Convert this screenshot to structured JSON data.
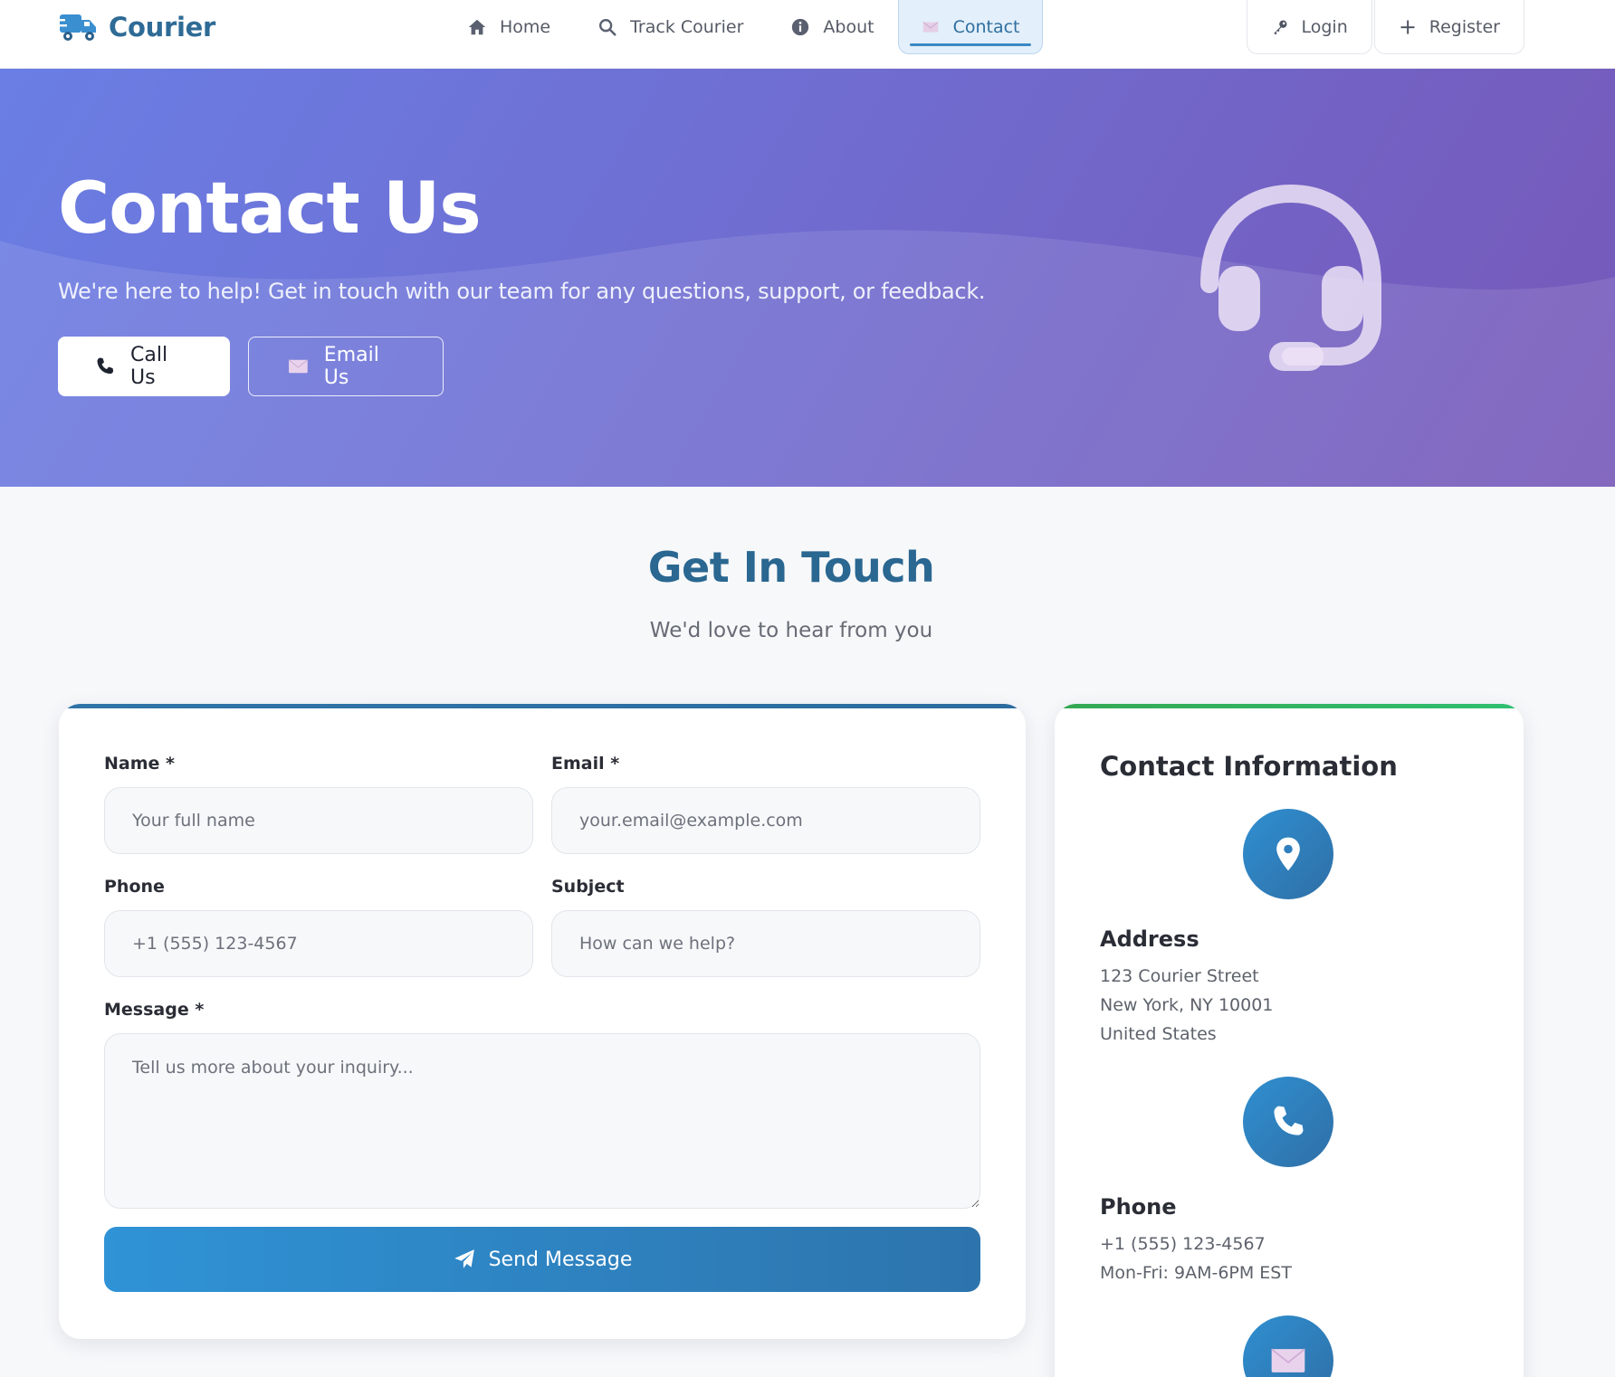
{
  "brand": {
    "name": "Courier"
  },
  "nav": {
    "links": [
      {
        "label": "Home",
        "icon": "home-icon"
      },
      {
        "label": "Track Courier",
        "icon": "search-icon"
      },
      {
        "label": "About",
        "icon": "info-icon"
      },
      {
        "label": "Contact",
        "icon": "envelope-icon",
        "active": true
      }
    ],
    "login": "Login",
    "register": "Register"
  },
  "hero": {
    "title": "Contact Us",
    "subtitle": "We're here to help! Get in touch with our team for any questions, support, or feedback.",
    "call_button": "Call Us",
    "email_button": "Email Us",
    "icon": "headset-icon"
  },
  "section": {
    "title": "Get In Touch",
    "subtitle": "We'd love to hear from you"
  },
  "form": {
    "name_label": "Name *",
    "name_placeholder": "Your full name",
    "email_label": "Email *",
    "email_placeholder": "your.email@example.com",
    "phone_label": "Phone",
    "phone_placeholder": "+1 (555) 123-4567",
    "subject_label": "Subject",
    "subject_placeholder": "How can we help?",
    "message_label": "Message *",
    "message_placeholder": "Tell us more about your inquiry...",
    "submit": "Send Message"
  },
  "contact_info": {
    "title": "Contact Information",
    "address": {
      "heading": "Address",
      "lines": [
        "123 Courier Street",
        "New York, NY 10001",
        "United States"
      ]
    },
    "phone": {
      "heading": "Phone",
      "lines": [
        "+1 (555) 123-4567",
        "Mon-Fri: 9AM-6PM EST"
      ]
    }
  },
  "colors": {
    "brand": "#2e6b96",
    "hero_start": "#6a7ee4",
    "hero_end": "#7658b8",
    "primary_button": "#2f93d6",
    "info_accent": "#34a853"
  }
}
